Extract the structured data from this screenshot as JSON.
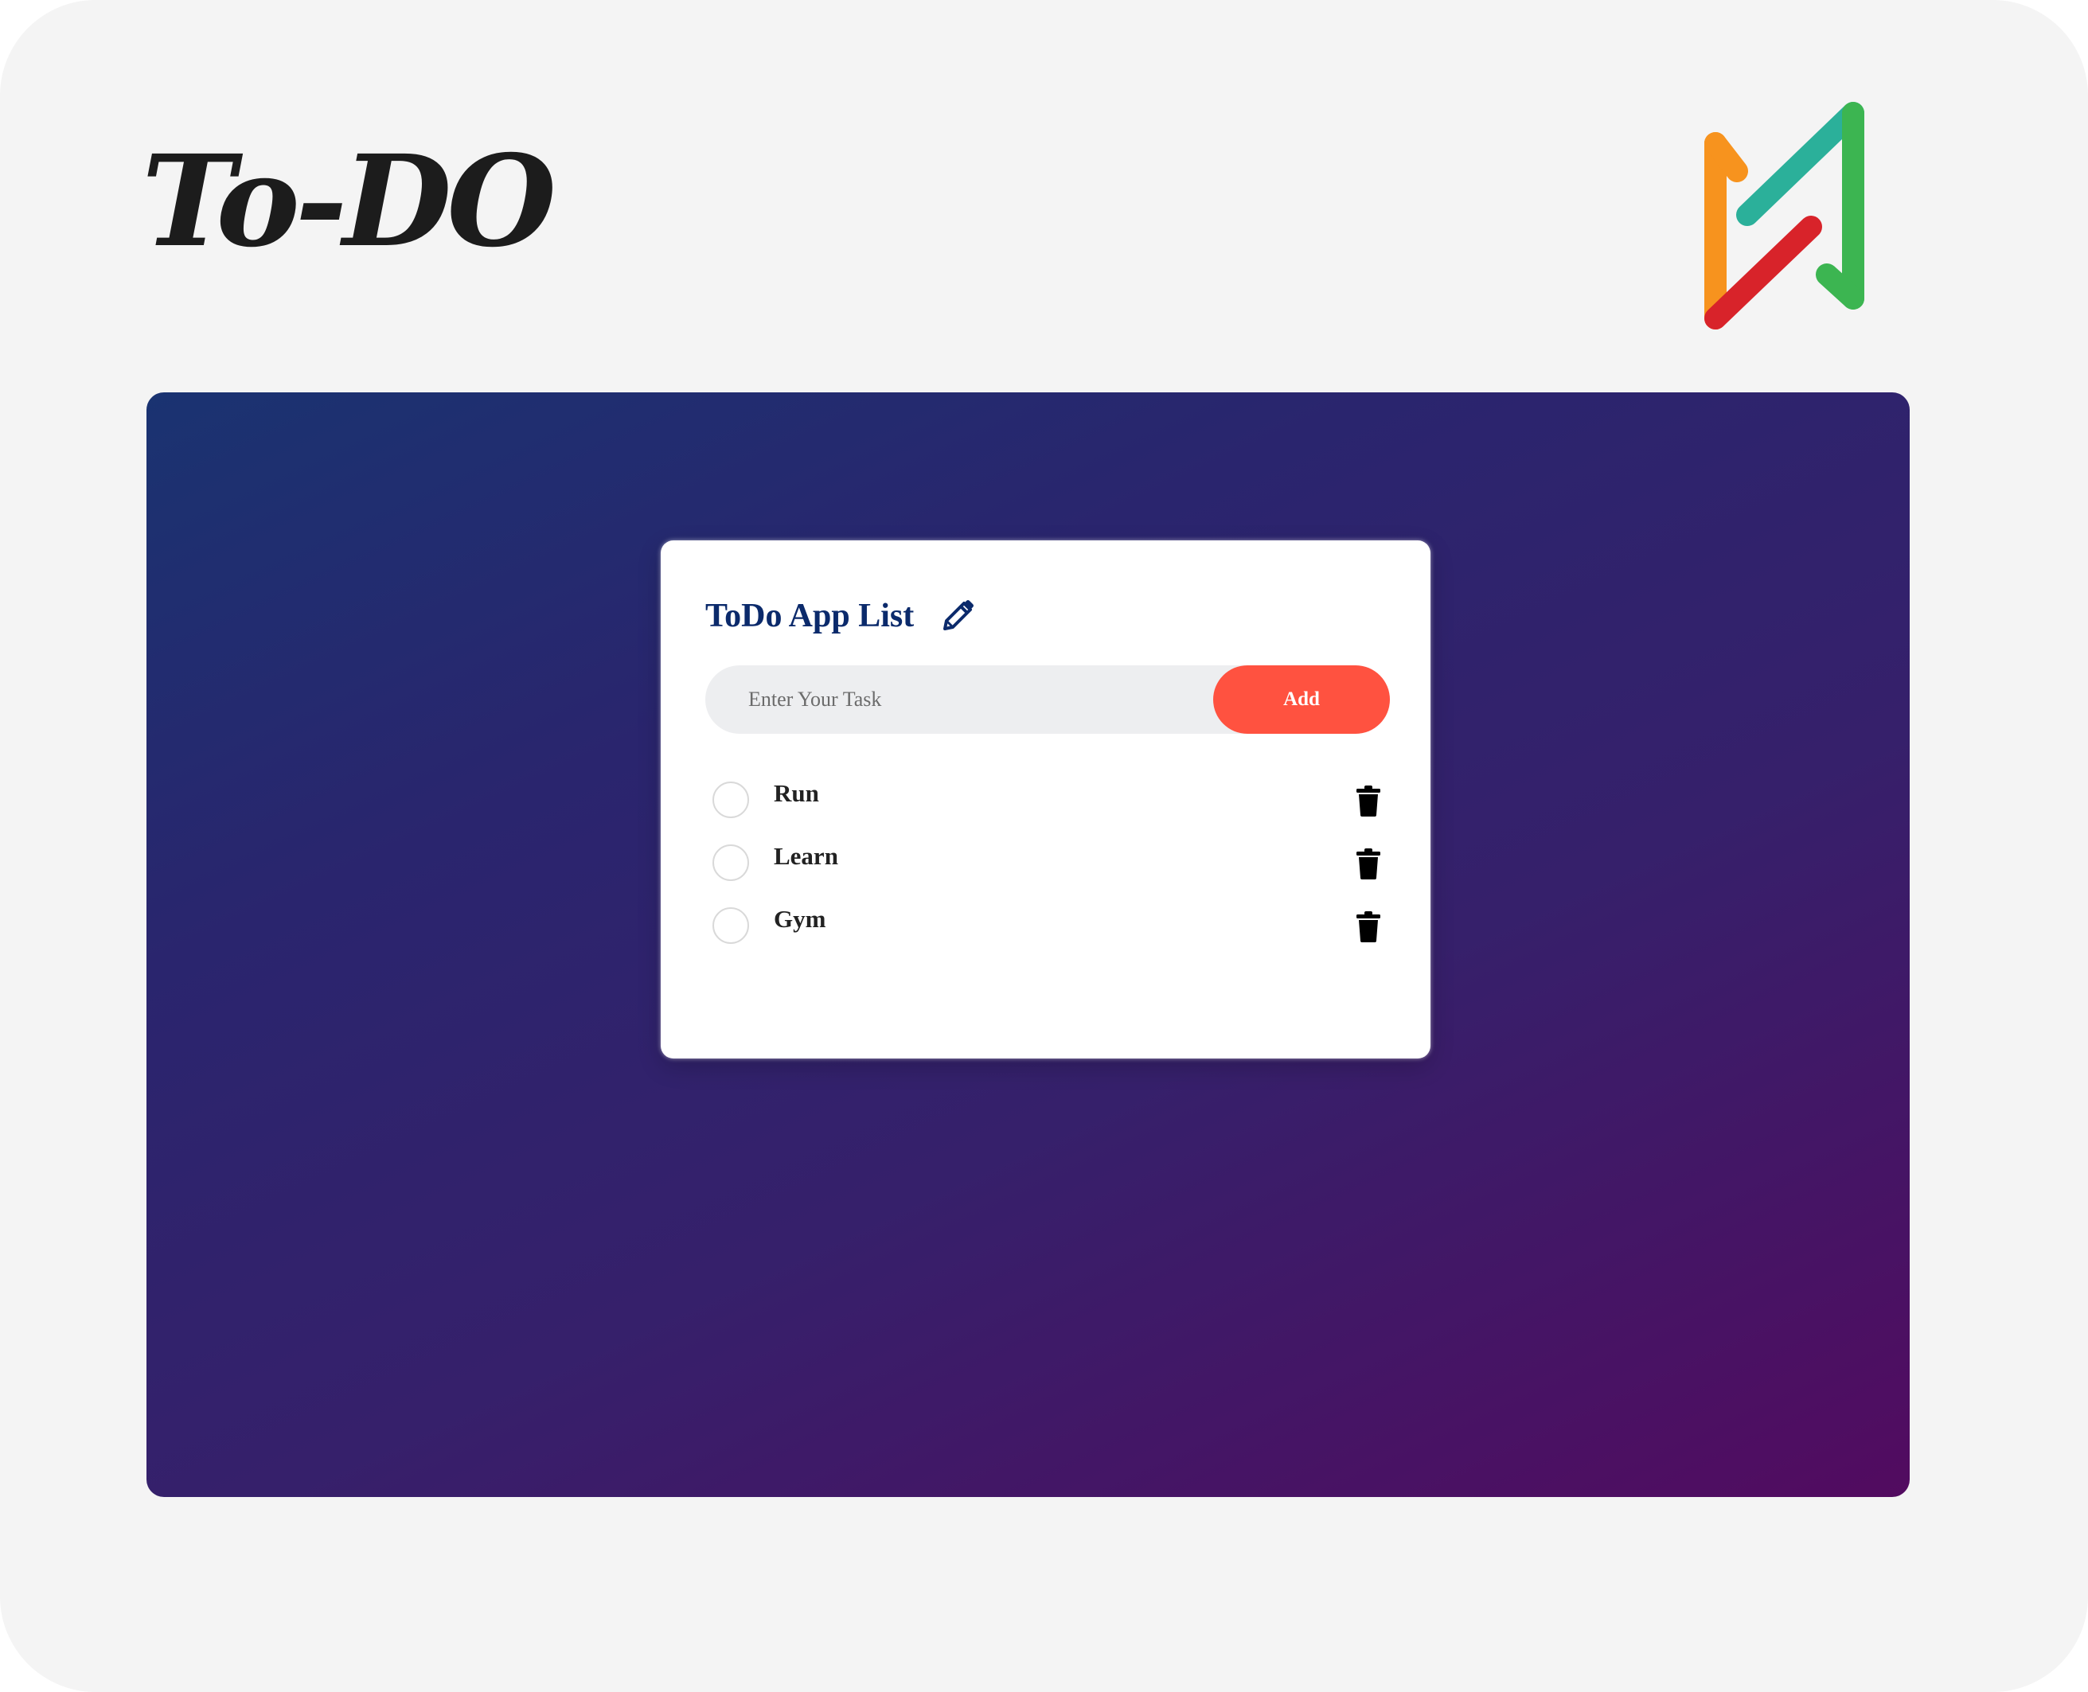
{
  "brand": {
    "title": "To-DO",
    "logo_icon": "brand-logo-icon"
  },
  "card": {
    "title": "ToDo App List",
    "title_icon": "pencil-icon",
    "input": {
      "placeholder": "Enter Your Task",
      "value": ""
    },
    "add_label": "Add",
    "tasks": [
      {
        "label": "Run",
        "checked": false
      },
      {
        "label": "Learn",
        "checked": false
      },
      {
        "label": "Gym",
        "checked": false
      }
    ],
    "delete_icon": "trash-icon"
  },
  "colors": {
    "page_bg": "#f4f4f4",
    "gradient_start": "#1a3371",
    "gradient_end": "#520b60",
    "title_color": "#0b2a6b",
    "accent": "#ff5240",
    "input_bg": "#edeef0"
  }
}
